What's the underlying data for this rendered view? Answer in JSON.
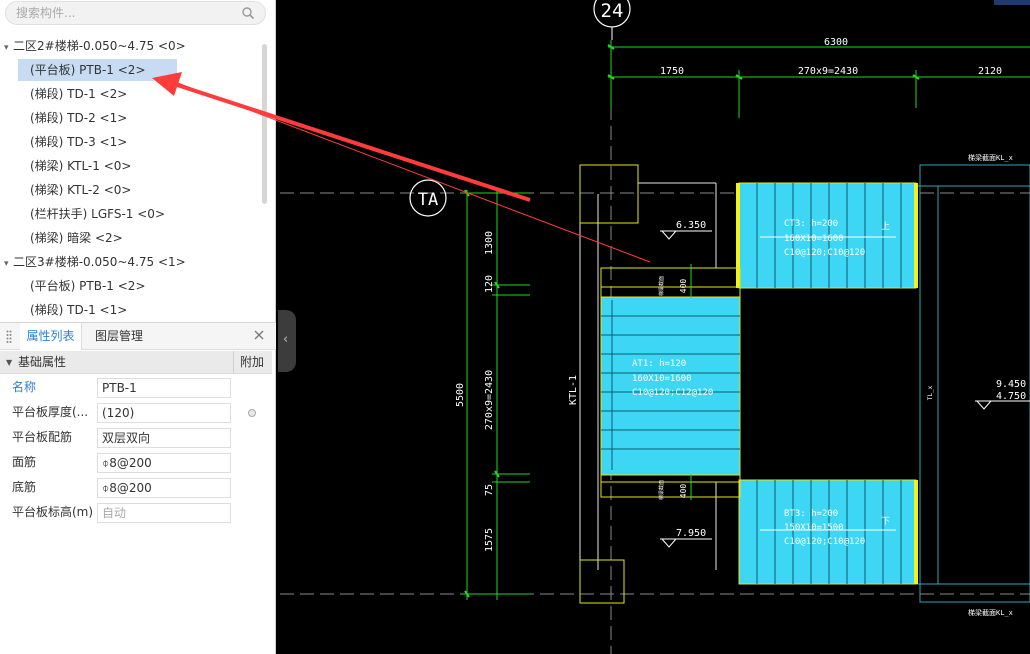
{
  "search": {
    "placeholder": "搜索构件..."
  },
  "tree": [
    {
      "type": "group",
      "label": "二区2#楼梯-0.050~4.75 <0>"
    },
    {
      "type": "item",
      "label": "(平台板) PTB-1 <2>",
      "selected": true
    },
    {
      "type": "item",
      "label": "(梯段) TD-1 <2>"
    },
    {
      "type": "item",
      "label": "(梯段) TD-2 <1>"
    },
    {
      "type": "item",
      "label": "(梯段) TD-3 <1>"
    },
    {
      "type": "item",
      "label": "(梯梁) KTL-1 <0>"
    },
    {
      "type": "item",
      "label": "(梯梁) KTL-2 <0>"
    },
    {
      "type": "item",
      "label": "(栏杆扶手) LGFS-1 <0>"
    },
    {
      "type": "item",
      "label": "(梯梁) 暗梁 <2>"
    },
    {
      "type": "group",
      "label": "二区3#楼梯-0.050~4.75 <1>"
    },
    {
      "type": "item",
      "label": "(平台板) PTB-1 <2>"
    },
    {
      "type": "item",
      "label": "(梯段) TD-1 <1>"
    }
  ],
  "panel_tabs": {
    "attr": "属性列表",
    "layer": "图层管理"
  },
  "section": {
    "title": "基础属性",
    "extra": "附加"
  },
  "properties": [
    {
      "label": "名称",
      "value": "PTB-1",
      "blue": true
    },
    {
      "label": "平台板厚度(...",
      "value": "(120)",
      "dot": true
    },
    {
      "label": "平台板配筋",
      "value": "双层双向"
    },
    {
      "label": "面筋",
      "value": "⌽8@200"
    },
    {
      "label": "底筋",
      "value": "⌽8@200"
    },
    {
      "label": "平台板标高(m)",
      "value": "自动",
      "muted": true
    }
  ],
  "cad": {
    "axis_24": "24",
    "axis_TA": "TA",
    "dim_top": "6300",
    "dim_1750": "1750",
    "dim_270x9": "270x9=2430",
    "dim_2120": "2120",
    "dim_1300": "1300",
    "dim_120": "120",
    "dim_270x9_v": "270x9=2430",
    "dim_75": "75",
    "dim_1575": "1575",
    "dim_5500": "5500",
    "elev_6350": "6.350",
    "elev_7950": "7.950",
    "elev_9450": "9.450",
    "elev_4750": "4.750",
    "ktl": "KTL-1",
    "d400a": "400",
    "d400b": "400",
    "ct3_1": "CT3: h=200",
    "ct3_2": "160X10=1600",
    "ct3_3": "C10@120;C10@120",
    "at1_1": "AT1: h=120",
    "at1_2": "160X10=1600",
    "at1_3": "C10@120;C12@120",
    "bt3_1": "BT3: h=200",
    "bt3_2": "150X10=1500",
    "bt3_3": "C10@120;C10@120",
    "up": "上",
    "down": "下",
    "beam_tag": "梯梁截面",
    "tl_small": "TL_x",
    "corner1": "梯梁截面KL_x",
    "corner2": "梯梁截面KL_x"
  }
}
